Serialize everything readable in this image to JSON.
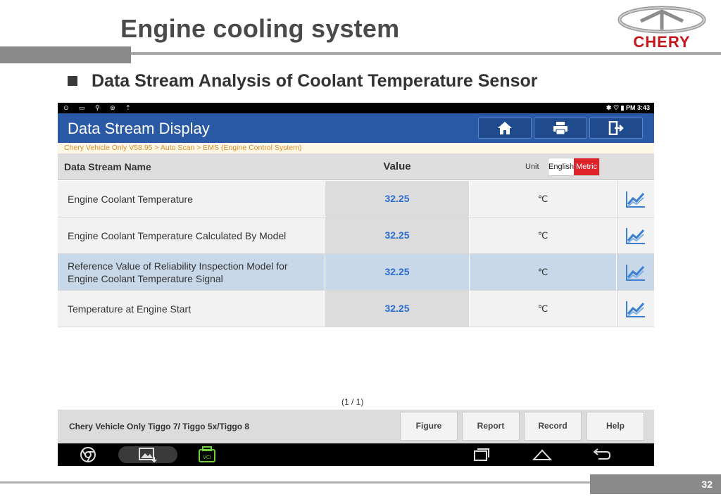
{
  "slide": {
    "title": "Engine cooling system",
    "bullet": "Data Stream Analysis of Coolant Temperature Sensor",
    "logo_text": "CHERY",
    "page_number": "32"
  },
  "tablet": {
    "status_time": "PM 3:43",
    "app_title": "Data Stream Display",
    "breadcrumb": "Chery Vehicle Only V58.95 > Auto Scan > EMS (Engine Control System)",
    "header_buttons": [
      "home-icon",
      "print-icon",
      "exit-icon"
    ],
    "table": {
      "col_name": "Data Stream Name",
      "col_value": "Value",
      "col_unit": "Unit",
      "unit_english": "English",
      "unit_metric": "Metric",
      "rows": [
        {
          "name": "Engine Coolant Temperature",
          "value": "32.25",
          "unit": "℃"
        },
        {
          "name": "Engine Coolant Temperature Calculated By Model",
          "value": "32.25",
          "unit": "℃"
        },
        {
          "name": "Reference Value of Reliability Inspection Model for Engine Coolant Temperature Signal",
          "value": "32.25",
          "unit": "℃"
        },
        {
          "name": "Temperature at Engine Start",
          "value": "32.25",
          "unit": "℃"
        }
      ]
    },
    "pager": "(1 / 1)",
    "footer_label": "Chery Vehicle Only Tiggo 7/ Tiggo 5x/Tiggo 8",
    "buttons": {
      "figure": "Figure",
      "report": "Report",
      "record": "Record",
      "help": "Help"
    },
    "vci_label": "VCI"
  },
  "colors": {
    "header_blue": "#2a5aa5",
    "value_blue": "#2a6cd4",
    "metric_red": "#e0232b",
    "logo_red": "#c4161c"
  }
}
